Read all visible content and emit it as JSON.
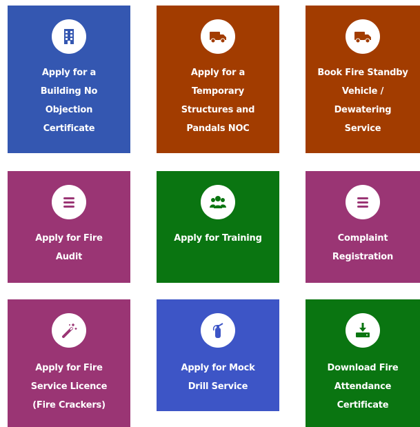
{
  "colors": {
    "blue": "#3457b1",
    "orange": "#a23c00",
    "purple": "#9a3574",
    "green": "#0a7511",
    "mock_blue": "#3d55c6"
  },
  "tiles": [
    {
      "name": "building-noc",
      "icon": "building-icon",
      "color": "#3457b1",
      "lines": [
        "Apply for a",
        "Building No",
        "Objection",
        "Certificate"
      ]
    },
    {
      "name": "temporary-structures-noc",
      "icon": "truck-icon",
      "color": "#a23c00",
      "lines": [
        "Apply for a",
        "Temporary",
        "Structures and",
        "Pandals NOC"
      ]
    },
    {
      "name": "fire-standby-vehicle",
      "icon": "truck-icon",
      "color": "#a23c00",
      "lines": [
        "Book Fire Standby",
        "Vehicle /",
        "Dewatering",
        "Service"
      ]
    },
    {
      "name": "fire-audit",
      "icon": "list-icon",
      "color": "#9a3574",
      "lines": [
        "Apply for Fire",
        "Audit"
      ]
    },
    {
      "name": "training",
      "icon": "users-icon",
      "color": "#0a7511",
      "lines": [
        "Apply for Training"
      ]
    },
    {
      "name": "complaint-registration",
      "icon": "list-icon",
      "color": "#9a3574",
      "lines": [
        "Complaint",
        "Registration"
      ]
    },
    {
      "name": "fire-service-licence",
      "icon": "magic-wand-icon",
      "color": "#9a3574",
      "lines": [
        "Apply for Fire",
        "Service Licence",
        "(Fire Crackers)"
      ]
    },
    {
      "name": "mock-drill-service",
      "icon": "fire-extinguisher-icon",
      "color": "#3d55c6",
      "lines": [
        "Apply for Mock",
        "Drill Service"
      ]
    },
    {
      "name": "download-fire-attendance-certificate",
      "icon": "download-icon",
      "color": "#0a7511",
      "lines": [
        "Download Fire",
        "Attendance",
        "Certificate"
      ]
    }
  ]
}
